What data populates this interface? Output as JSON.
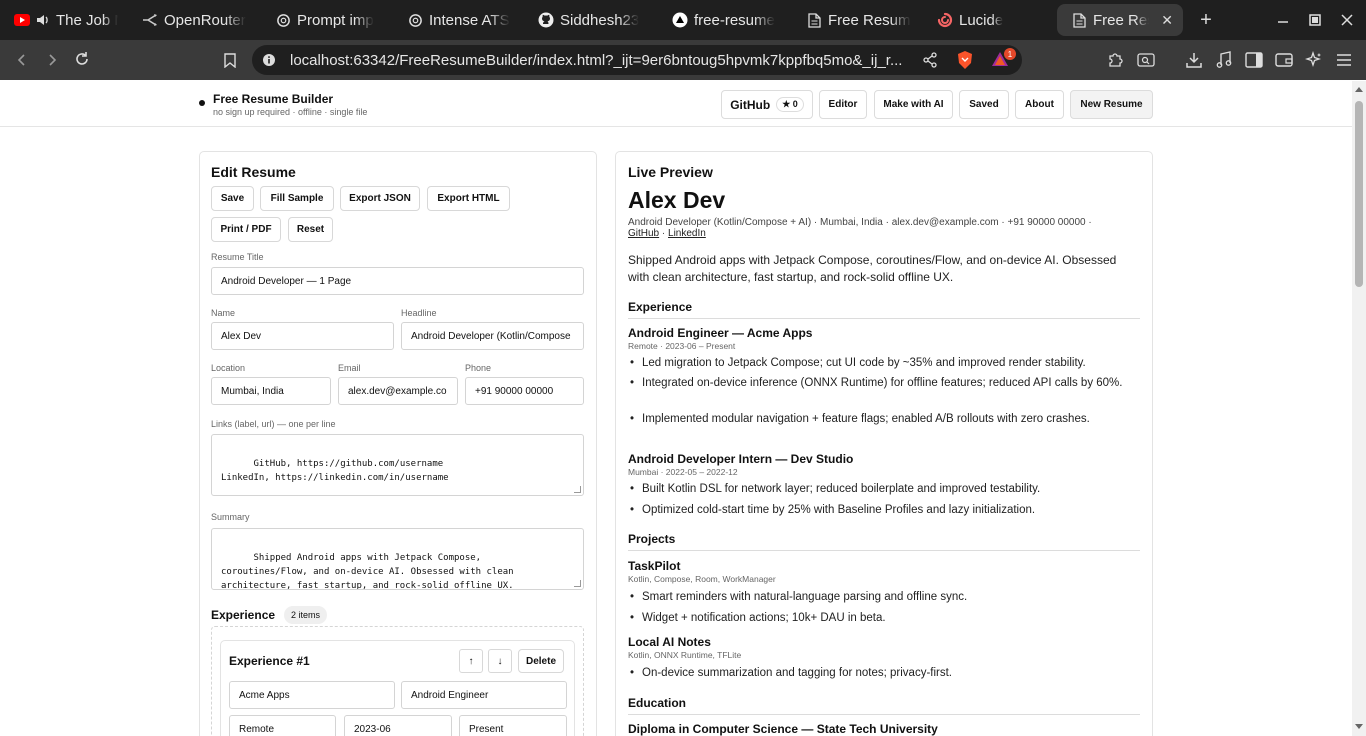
{
  "browser": {
    "tabs": [
      {
        "title": "The Job M",
        "icon": "youtube-icon"
      },
      {
        "title": "OpenRouter",
        "icon": "openrouter-icon"
      },
      {
        "title": "Prompt imp",
        "icon": "openai-icon"
      },
      {
        "title": "Intense ATS",
        "icon": "openai-icon"
      },
      {
        "title": "Siddhesh23",
        "icon": "github-icon"
      },
      {
        "title": "free-resume",
        "icon": "vercel-icon"
      },
      {
        "title": "Free Resum",
        "icon": "document-icon"
      },
      {
        "title": "Lucide",
        "icon": "lucide-icon"
      },
      {
        "title": "Free Resu",
        "icon": "document-icon",
        "active": true
      }
    ],
    "url": "localhost:63342/FreeResumeBuilder/index.html?_ijt=9er6bntoug5hpvmk7kppfbq5mo&_ij_r...",
    "brave_badge": "1"
  },
  "app": {
    "brand": "Free Resume Builder",
    "tagline": "no sign up required · offline · single file",
    "nav": {
      "github": "GitHub",
      "github_stars": "★ 0",
      "editor": "Editor",
      "make_ai": "Make with AI",
      "saved": "Saved",
      "about": "About",
      "new_resume": "New Resume"
    }
  },
  "editor": {
    "title": "Edit Resume",
    "buttons": {
      "save": "Save",
      "fill_sample": "Fill Sample",
      "export_json": "Export JSON",
      "export_html": "Export HTML",
      "print_pdf": "Print / PDF",
      "reset": "Reset"
    },
    "labels": {
      "resume_title": "Resume Title",
      "name": "Name",
      "headline": "Headline",
      "location": "Location",
      "email": "Email",
      "phone": "Phone",
      "links": "Links (label, url) — one per line",
      "summary": "Summary"
    },
    "values": {
      "resume_title": "Android Developer — 1 Page",
      "name": "Alex Dev",
      "headline": "Android Developer (Kotlin/Compose",
      "location": "Mumbai, India",
      "email": "alex.dev@example.co",
      "phone": "+91 90000 00000",
      "links": "GitHub, https://github.com/username\nLinkedIn, https://linkedin.com/in/username",
      "summary": "Shipped Android apps with Jetpack Compose,\ncoroutines/Flow, and on-device AI. Obsessed with clean\narchitecture, fast startup, and rock-solid offline UX."
    },
    "experience": {
      "heading": "Experience",
      "count": "2 items",
      "item_title": "Experience #1",
      "up": "↑",
      "down": "↓",
      "delete": "Delete",
      "company": "Acme Apps",
      "role": "Android Engineer",
      "location": "Remote",
      "start": "2023-06",
      "end": "Present"
    }
  },
  "preview": {
    "title": "Live Preview",
    "name": "Alex Dev",
    "contact": "Android Developer (Kotlin/Compose + AI) · Mumbai, India · alex.dev@example.com · +91 90000 00000 ·",
    "link1": "GitHub",
    "link_sep": " · ",
    "link2": "LinkedIn",
    "summary": "Shipped Android apps with Jetpack Compose, coroutines/Flow, and on-device AI. Obsessed with clean architecture, fast startup, and rock-solid offline UX.",
    "experience_heading": "Experience",
    "jobs": [
      {
        "role": "Android Engineer — Acme Apps",
        "meta": "Remote · 2023-06 – Present",
        "bullets": [
          "Led migration to Jetpack Compose; cut UI code by ~35% and improved render stability.",
          "Integrated on-device inference (ONNX Runtime) for offline features; reduced API calls by 60%.",
          "Implemented modular navigation + feature flags; enabled A/B rollouts with zero crashes."
        ]
      },
      {
        "role": "Android Developer Intern — Dev Studio",
        "meta": "Mumbai · 2022-05 – 2022-12",
        "bullets": [
          "Built Kotlin DSL for network layer; reduced boilerplate and improved testability.",
          "Optimized cold-start time by 25% with Baseline Profiles and lazy initialization."
        ]
      }
    ],
    "projects_heading": "Projects",
    "projects": [
      {
        "name": "TaskPilot",
        "tech": "Kotlin, Compose, Room, WorkManager",
        "bullets": [
          "Smart reminders with natural-language parsing and offline sync.",
          "Widget + notification actions; 10k+ DAU in beta."
        ]
      },
      {
        "name": "Local AI Notes",
        "tech": "Kotlin, ONNX Runtime, TFLite",
        "bullets": [
          "On-device summarization and tagging for notes; privacy-first."
        ]
      }
    ],
    "education_heading": "Education",
    "education_entry": "Diploma in Computer Science — State Tech University"
  },
  "colors": {
    "tabbar_bg": "#1f1f1f",
    "toolbar_bg": "#3a3a3a",
    "youtube_red": "#ff0000",
    "lucide_red": "#f56565",
    "brave_orange": "#fb542b"
  }
}
